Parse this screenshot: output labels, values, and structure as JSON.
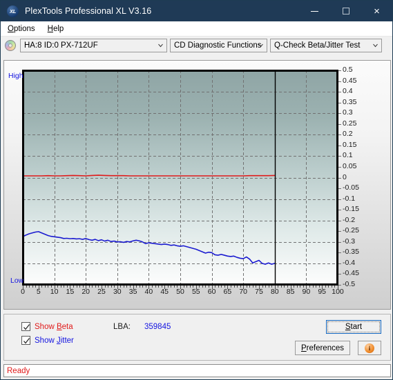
{
  "window": {
    "title": "PlexTools Professional XL V3.16",
    "app_icon": "xl-disc-icon",
    "minimize_label": "minimize-icon",
    "maximize_label": "maximize-icon",
    "close_label": "×"
  },
  "menubar": {
    "items": [
      {
        "label": "Options",
        "mnemonic": "O"
      },
      {
        "label": "Help",
        "mnemonic": "H"
      }
    ]
  },
  "toolbar": {
    "disc_icon": "cd-disc-icon",
    "drive_select": {
      "value": "HA:8 ID:0  PX-712UF",
      "options": [
        "HA:8 ID:0  PX-712UF"
      ]
    },
    "function_select": {
      "value": "CD Diagnostic Functions",
      "options": [
        "CD Diagnostic Functions"
      ]
    },
    "test_select": {
      "value": "Q-Check Beta/Jitter Test",
      "options": [
        "Q-Check Beta/Jitter Test"
      ]
    }
  },
  "chart_data": {
    "type": "line",
    "title": "",
    "xlabel": "",
    "ylabel": "",
    "xlim": [
      0,
      100
    ],
    "ylim": [
      -0.5,
      0.5
    ],
    "grid": true,
    "legend": "none",
    "left_axis_top_label": "High",
    "left_axis_bottom_label": "Low",
    "ytick_labels": [
      "0.5",
      "0.45",
      "0.4",
      "0.35",
      "0.3",
      "0.25",
      "0.2",
      "0.15",
      "0.1",
      "0.05",
      "0",
      "-0.05",
      "-0.1",
      "-0.15",
      "-0.2",
      "-0.25",
      "-0.3",
      "-0.35",
      "-0.4",
      "-0.45",
      "-0.5"
    ],
    "ytick_values": [
      0.5,
      0.45,
      0.4,
      0.35,
      0.3,
      0.25,
      0.2,
      0.15,
      0.1,
      0.05,
      0,
      -0.05,
      -0.1,
      -0.15,
      -0.2,
      -0.25,
      -0.3,
      -0.35,
      -0.4,
      -0.45,
      -0.5
    ],
    "xtick_labels": [
      "0",
      "5",
      "10",
      "15",
      "20",
      "25",
      "30",
      "35",
      "40",
      "45",
      "50",
      "55",
      "60",
      "65",
      "70",
      "75",
      "80",
      "85",
      "90",
      "95",
      "100"
    ],
    "xtick_values": [
      0,
      5,
      10,
      15,
      20,
      25,
      30,
      35,
      40,
      45,
      50,
      55,
      60,
      65,
      70,
      75,
      80,
      85,
      90,
      95,
      100
    ],
    "marker_line_x": 80,
    "series": [
      {
        "name": "Beta",
        "color": "#e01a1a",
        "x": [
          0,
          2,
          4,
          6,
          8,
          10,
          12,
          14,
          16,
          18,
          20,
          22,
          24,
          26,
          28,
          30,
          32,
          34,
          36,
          38,
          40,
          42,
          44,
          46,
          48,
          50,
          52,
          54,
          56,
          58,
          60,
          62,
          64,
          66,
          68,
          70,
          72,
          74,
          76,
          78,
          80
        ],
        "values": [
          0.008,
          0.008,
          0.008,
          0.008,
          0.009,
          0.008,
          0.008,
          0.009,
          0.01,
          0.009,
          0.008,
          0.01,
          0.011,
          0.01,
          0.009,
          0.009,
          0.009,
          0.008,
          0.008,
          0.008,
          0.008,
          0.008,
          0.008,
          0.008,
          0.008,
          0.008,
          0.008,
          0.008,
          0.008,
          0.008,
          0.008,
          0.008,
          0.008,
          0.008,
          0.008,
          0.008,
          0.009,
          0.009,
          0.009,
          0.009,
          0.01
        ]
      },
      {
        "name": "Jitter",
        "color": "#1a1ad0",
        "x": [
          0,
          1,
          2,
          3,
          4,
          5,
          6,
          7,
          8,
          9,
          10,
          11,
          12,
          13,
          14,
          15,
          16,
          17,
          18,
          19,
          20,
          21,
          22,
          23,
          24,
          25,
          26,
          27,
          28,
          29,
          30,
          31,
          32,
          33,
          34,
          35,
          36,
          37,
          38,
          39,
          40,
          41,
          42,
          43,
          44,
          45,
          46,
          47,
          48,
          49,
          50,
          51,
          52,
          53,
          54,
          55,
          56,
          57,
          58,
          59,
          60,
          61,
          62,
          63,
          64,
          65,
          66,
          67,
          68,
          69,
          70,
          71,
          72,
          73,
          74,
          75,
          76,
          77,
          78,
          79,
          80
        ],
        "values": [
          -0.275,
          -0.268,
          -0.262,
          -0.258,
          -0.254,
          -0.252,
          -0.258,
          -0.264,
          -0.27,
          -0.274,
          -0.276,
          -0.278,
          -0.28,
          -0.284,
          -0.283,
          -0.285,
          -0.284,
          -0.286,
          -0.285,
          -0.288,
          -0.284,
          -0.289,
          -0.292,
          -0.288,
          -0.294,
          -0.29,
          -0.296,
          -0.292,
          -0.298,
          -0.296,
          -0.3,
          -0.299,
          -0.302,
          -0.298,
          -0.3,
          -0.295,
          -0.292,
          -0.295,
          -0.3,
          -0.308,
          -0.304,
          -0.306,
          -0.308,
          -0.31,
          -0.312,
          -0.31,
          -0.312,
          -0.316,
          -0.314,
          -0.318,
          -0.32,
          -0.318,
          -0.322,
          -0.326,
          -0.33,
          -0.334,
          -0.34,
          -0.346,
          -0.352,
          -0.348,
          -0.35,
          -0.36,
          -0.362,
          -0.358,
          -0.362,
          -0.366,
          -0.368,
          -0.366,
          -0.372,
          -0.376,
          -0.378,
          -0.37,
          -0.38,
          -0.398,
          -0.392,
          -0.386,
          -0.4,
          -0.404,
          -0.398,
          -0.404,
          -0.4
        ]
      }
    ]
  },
  "controls": {
    "show_beta": {
      "label_pre": "Show ",
      "label_mnemonic": "B",
      "label_post": "eta",
      "checked": true
    },
    "show_jitter": {
      "label_pre": "Show ",
      "label_mnemonic": "J",
      "label_post": "itter",
      "checked": true
    },
    "lba_label": "LBA:",
    "lba_value": "359845",
    "start_button": {
      "pre": "",
      "mnemonic": "S",
      "post": "tart"
    },
    "preferences_button": {
      "pre": "",
      "mnemonic": "P",
      "post": "references"
    },
    "info_button": {
      "icon": "info-icon",
      "glyph": "i"
    }
  },
  "statusbar": {
    "text": "Ready"
  }
}
